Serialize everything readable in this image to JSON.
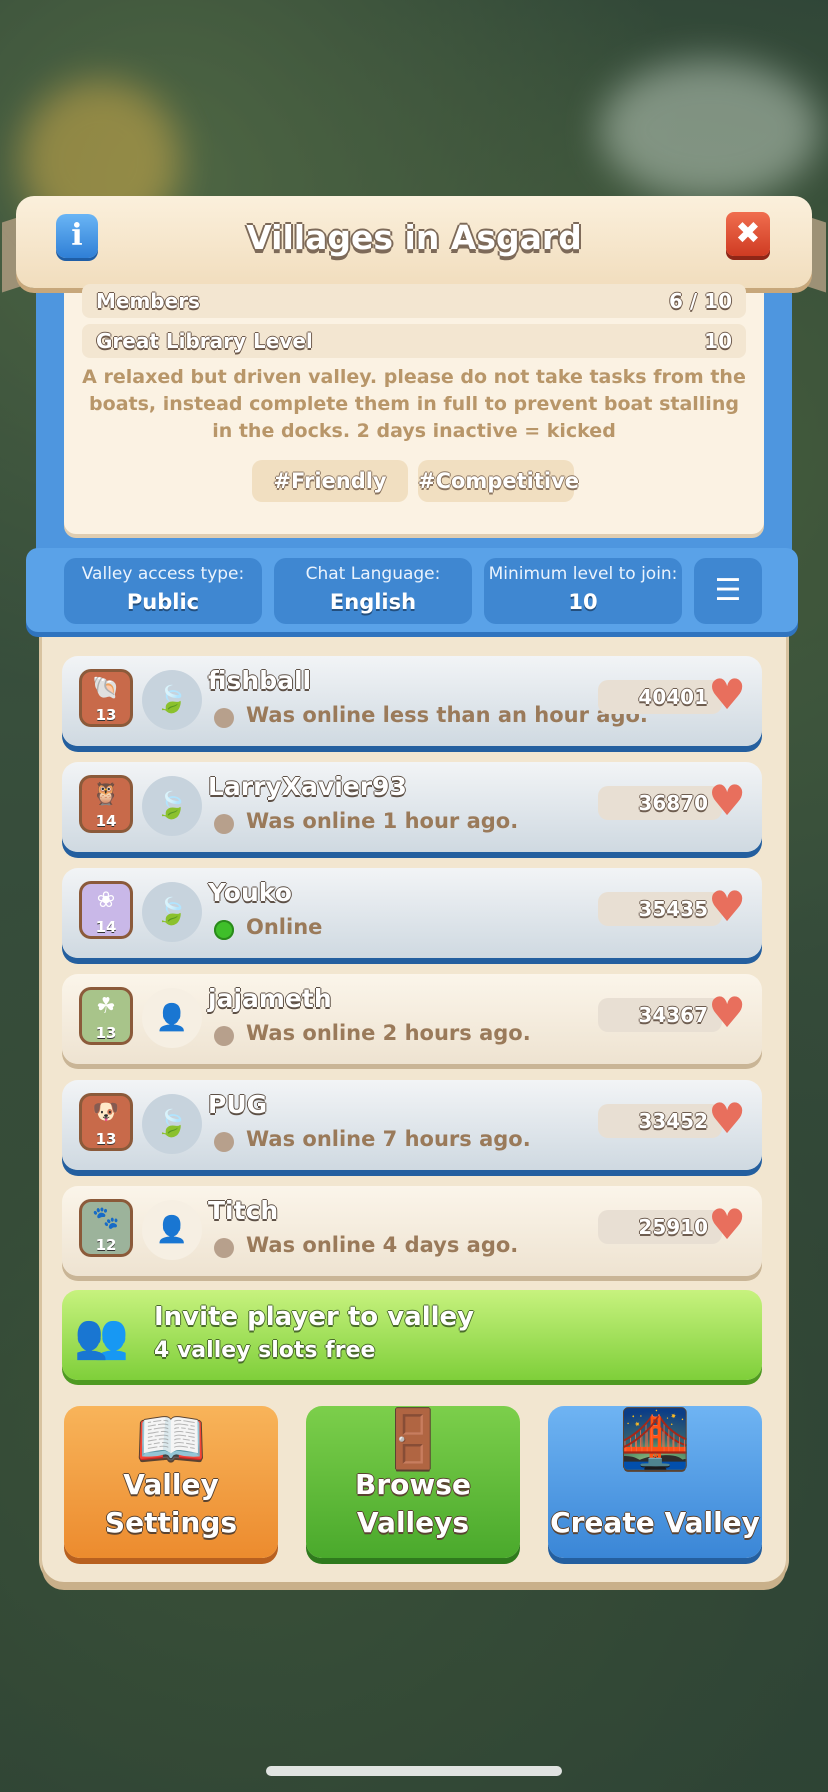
{
  "header": {
    "title": "Villages in Asgard"
  },
  "stats": [
    {
      "label": "Members",
      "value": "6 / 10"
    },
    {
      "label": "Great Library Level",
      "value": "10"
    }
  ],
  "description": "A relaxed but driven valley. please do not take tasks from the boats, instead complete them in full to prevent boat stalling in the docks. 2 days inactive = kicked",
  "tags": [
    "#Friendly",
    "#Competitive"
  ],
  "settings": {
    "access_label": "Valley access type:",
    "access_value": "Public",
    "chat_label": "Chat Language:",
    "chat_value": "English",
    "minlevel_label": "Minimum level to join:",
    "minlevel_value": "10"
  },
  "members": [
    {
      "name": "fishball",
      "level": "13",
      "status": "Was online less than an hour ago.",
      "score": "40401",
      "online": false,
      "icon": "shell-icon",
      "avatar": "leaf-icon"
    },
    {
      "name": "LarryXavier93",
      "level": "14",
      "status": "Was online 1 hour ago.",
      "score": "36870",
      "online": false,
      "icon": "owl-icon",
      "avatar": "leaf-icon"
    },
    {
      "name": "Youko",
      "level": "14",
      "status": "Online",
      "score": "35435",
      "online": true,
      "icon": "flower-icon",
      "avatar": "leaf-icon"
    },
    {
      "name": "jajameth",
      "level": "13",
      "status": "Was online 2 hours ago.",
      "score": "34367",
      "online": false,
      "icon": "clover-icon",
      "avatar": "person-icon"
    },
    {
      "name": "PUG",
      "level": "13",
      "status": "Was online 7 hours ago.",
      "score": "33452",
      "online": false,
      "icon": "dog-icon",
      "avatar": "leaf-icon"
    },
    {
      "name": "Titch",
      "level": "12",
      "status": "Was online 4 days ago.",
      "score": "25910",
      "online": false,
      "icon": "paw-icon",
      "avatar": "person-icon"
    }
  ],
  "invite": {
    "title": "Invite player to valley",
    "subtitle": "4 valley slots free"
  },
  "actions": [
    {
      "label": "Valley Settings"
    },
    {
      "label": "Browse Valleys"
    },
    {
      "label": "Create Valley"
    }
  ]
}
